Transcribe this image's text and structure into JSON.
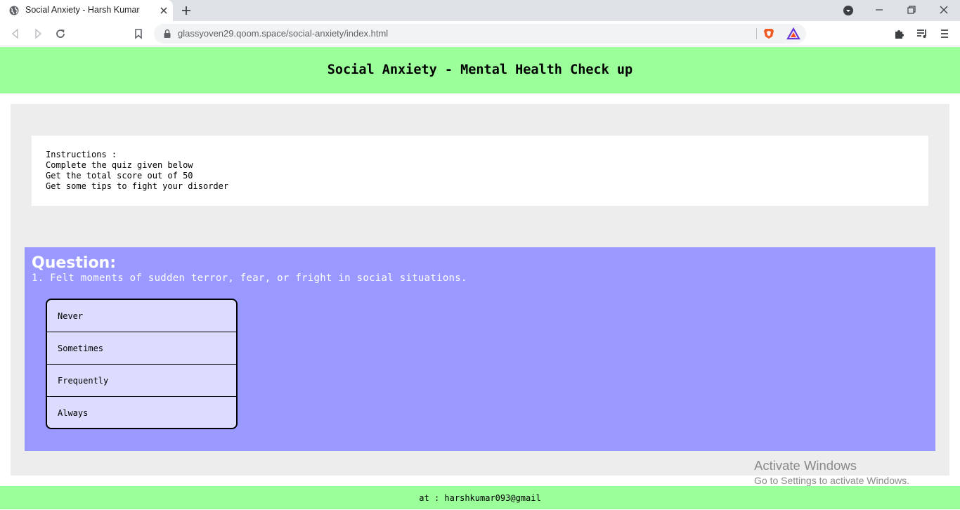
{
  "browser": {
    "tab_title": "Social Anxiety - Harsh Kumar",
    "url": "glassyoven29.qoom.space/social-anxiety/index.html"
  },
  "page": {
    "header_title": "Social Anxiety - Mental Health Check up",
    "instructions": [
      "Instructions :",
      "Complete the quiz given below",
      "Get the total score out of 50",
      "Get some tips to fight your disorder"
    ],
    "question": {
      "heading": "Question:",
      "text": "1. Felt moments of sudden terror, fear, or fright in social situations.",
      "options": [
        "Never",
        "Sometimes",
        "Frequently",
        "Always"
      ]
    },
    "footer": "at : harshkumar093@gmail"
  },
  "os_watermark": {
    "title": "Activate Windows",
    "subtitle": "Go to Settings to activate Windows."
  },
  "colors": {
    "header_bg": "#9bff9a",
    "container_bg": "#ededed",
    "question_bg": "#9999ff",
    "option_bg": "#dcdcff"
  }
}
